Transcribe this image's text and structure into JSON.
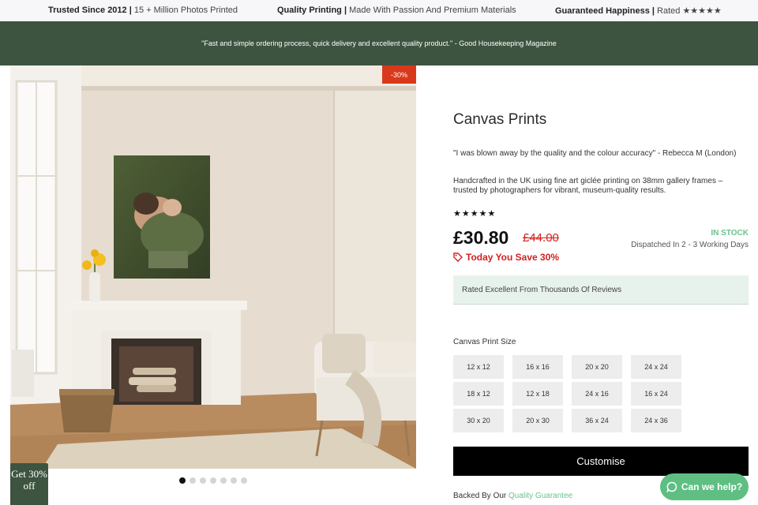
{
  "trust_bar": {
    "items": [
      {
        "bold": "Trusted Since 2012",
        "sep": " | ",
        "text": "15 + Million Photos Printed"
      },
      {
        "bold": "Quality Printing",
        "sep": " | ",
        "text": "Made With Passion And Premium Materials"
      },
      {
        "bold": "Guaranteed Happiness",
        "sep": " | ",
        "text": "Rated ★★★★★"
      }
    ]
  },
  "banner": {
    "quote": "\"Fast and simple ordering process, quick delivery and excellent quality product.\" - Good Housekeeping Magazine"
  },
  "gallery": {
    "discount_badge": "-30%",
    "dot_count": 7,
    "active_dot": 0,
    "promo_tab": "Get 30% off"
  },
  "product": {
    "title": "Canvas Prints",
    "review_quote": "\"I was blown away by the quality and the colour accuracy\" - Rebecca M (London)",
    "description": "Handcrafted in the UK using fine art giclée printing on 38mm gallery frames – trusted by photographers for vibrant, museum-quality results.",
    "stars": "★★★★★",
    "price": "£30.80",
    "old_price": "£44.00",
    "save_text": "Today You Save 30%",
    "stock_status": "IN STOCK",
    "dispatch": "Dispatched In 2 - 3 Working Days",
    "reviews_banner": "Rated Excellent From Thousands Of Reviews",
    "size_label": "Canvas Print Size",
    "sizes": [
      "12 x 12",
      "16 x 16",
      "20 x 20",
      "24 x 24",
      "18 x 12",
      "12 x 18",
      "24 x 16",
      "16 x 24",
      "30 x 20",
      "20 x 30",
      "36 x 24",
      "24 x 36"
    ],
    "customise_label": "Customise",
    "guarantee_prefix": "Backed By Our ",
    "guarantee_link": "Quality Guarantee"
  },
  "chat": {
    "label": "Can we help?"
  },
  "colors": {
    "brand_green": "#3d5440",
    "accent_green": "#6bc08d",
    "sale_red": "#d32020",
    "badge_red": "#d9391b"
  }
}
